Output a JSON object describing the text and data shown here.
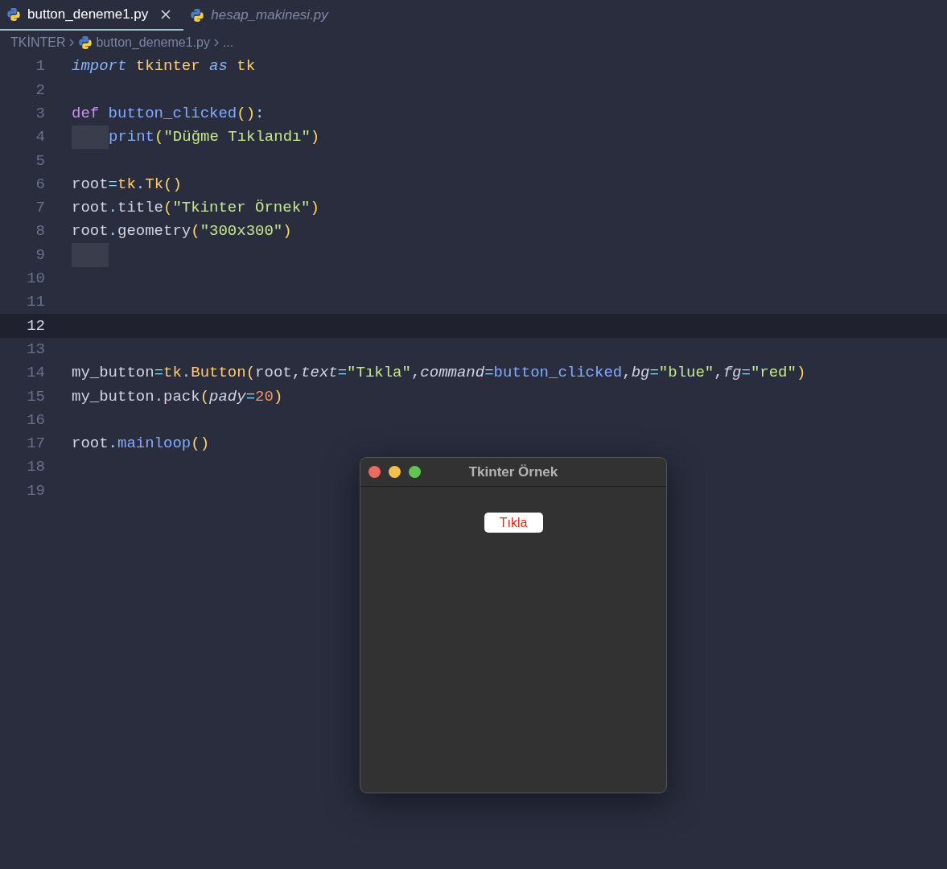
{
  "tabs": [
    {
      "label": "button_deneme1.py",
      "selected": true
    },
    {
      "label": "hesap_makinesi.py",
      "selected": false
    }
  ],
  "breadcrumb": {
    "folder": "TKİNTER",
    "file": "button_deneme1.py",
    "more": "..."
  },
  "code_lines": [
    {
      "number": "1",
      "current": false,
      "indent_marker": false,
      "tokens": [
        {
          "kind": "keyword",
          "text": "import "
        },
        {
          "kind": "module",
          "text": "tkinter "
        },
        {
          "kind": "keyword",
          "text": "as "
        },
        {
          "kind": "module",
          "text": "tk"
        }
      ]
    },
    {
      "number": "2",
      "current": false,
      "indent_marker": false
    },
    {
      "number": "3",
      "current": false,
      "indent_marker": false,
      "tokens": [
        {
          "kind": "storage",
          "text": "def "
        },
        {
          "kind": "func",
          "text": "button_clicked"
        },
        {
          "kind": "paren",
          "text": "()"
        },
        {
          "kind": "punct",
          "text": ":"
        }
      ]
    },
    {
      "number": "4",
      "current": false,
      "indent_marker": true,
      "tokens": [
        {
          "kind": "func",
          "text": "print"
        },
        {
          "kind": "paren",
          "text": "("
        },
        {
          "kind": "string",
          "text": "\"Düğme Tıklandı\""
        },
        {
          "kind": "paren",
          "text": ")"
        }
      ]
    },
    {
      "number": "5",
      "current": false,
      "indent_marker": false
    },
    {
      "number": "6",
      "current": false,
      "indent_marker": false,
      "tokens": [
        {
          "kind": "plain",
          "text": "root"
        },
        {
          "kind": "punct",
          "text": "="
        },
        {
          "kind": "module",
          "text": "tk"
        },
        {
          "kind": "punct",
          "text": "."
        },
        {
          "kind": "module",
          "text": "Tk"
        },
        {
          "kind": "paren",
          "text": "()"
        }
      ]
    },
    {
      "number": "7",
      "current": false,
      "indent_marker": false,
      "tokens": [
        {
          "kind": "plain",
          "text": "root"
        },
        {
          "kind": "punct",
          "text": "."
        },
        {
          "kind": "plain",
          "text": "title"
        },
        {
          "kind": "paren",
          "text": "("
        },
        {
          "kind": "string",
          "text": "\"Tkinter Örnek\""
        },
        {
          "kind": "paren",
          "text": ")"
        }
      ]
    },
    {
      "number": "8",
      "current": false,
      "indent_marker": false,
      "tokens": [
        {
          "kind": "plain",
          "text": "root"
        },
        {
          "kind": "punct",
          "text": "."
        },
        {
          "kind": "plain",
          "text": "geometry"
        },
        {
          "kind": "paren",
          "text": "("
        },
        {
          "kind": "string",
          "text": "\"300x300\""
        },
        {
          "kind": "paren",
          "text": ")"
        }
      ]
    },
    {
      "number": "9",
      "current": false,
      "indent_marker": true
    },
    {
      "number": "10",
      "current": false,
      "indent_marker": false
    },
    {
      "number": "11",
      "current": false,
      "indent_marker": false
    },
    {
      "number": "12",
      "current": true,
      "indent_marker": false
    },
    {
      "number": "13",
      "current": false,
      "indent_marker": false
    },
    {
      "number": "14",
      "current": false,
      "indent_marker": false,
      "tokens": [
        {
          "kind": "plain",
          "text": "my_button"
        },
        {
          "kind": "punct",
          "text": "="
        },
        {
          "kind": "module",
          "text": "tk"
        },
        {
          "kind": "punct",
          "text": "."
        },
        {
          "kind": "module",
          "text": "Button"
        },
        {
          "kind": "paren",
          "text": "("
        },
        {
          "kind": "plain",
          "text": "root,"
        },
        {
          "kind": "param",
          "text": "text"
        },
        {
          "kind": "punct",
          "text": "="
        },
        {
          "kind": "string",
          "text": "\"Tıkla\""
        },
        {
          "kind": "plain",
          "text": ","
        },
        {
          "kind": "param",
          "text": "command"
        },
        {
          "kind": "punct",
          "text": "="
        },
        {
          "kind": "func",
          "text": "button_clicked"
        },
        {
          "kind": "plain",
          "text": ","
        },
        {
          "kind": "param",
          "text": "bg"
        },
        {
          "kind": "punct",
          "text": "="
        },
        {
          "kind": "string",
          "text": "\"blue\""
        },
        {
          "kind": "plain",
          "text": ","
        },
        {
          "kind": "param",
          "text": "fg"
        },
        {
          "kind": "punct",
          "text": "="
        },
        {
          "kind": "string",
          "text": "\"red\""
        },
        {
          "kind": "paren",
          "text": ")"
        }
      ]
    },
    {
      "number": "15",
      "current": false,
      "indent_marker": false,
      "tokens": [
        {
          "kind": "plain",
          "text": "my_button"
        },
        {
          "kind": "punct",
          "text": "."
        },
        {
          "kind": "plain",
          "text": "pack"
        },
        {
          "kind": "paren",
          "text": "("
        },
        {
          "kind": "param",
          "text": "pady"
        },
        {
          "kind": "punct",
          "text": "="
        },
        {
          "kind": "number",
          "text": "20"
        },
        {
          "kind": "paren",
          "text": ")"
        }
      ]
    },
    {
      "number": "16",
      "current": false,
      "indent_marker": false
    },
    {
      "number": "17",
      "current": false,
      "indent_marker": false,
      "tokens": [
        {
          "kind": "plain",
          "text": "root"
        },
        {
          "kind": "punct",
          "text": "."
        },
        {
          "kind": "func",
          "text": "mainloop"
        },
        {
          "kind": "paren",
          "text": "()"
        }
      ]
    },
    {
      "number": "18",
      "current": false,
      "indent_marker": false
    },
    {
      "number": "19",
      "current": false,
      "indent_marker": false
    }
  ],
  "tk_window": {
    "title": "Tkinter Örnek",
    "button": "Tıkla"
  }
}
